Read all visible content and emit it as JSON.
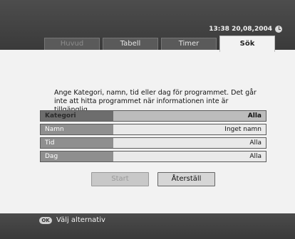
{
  "header": {
    "datetime": "13:38 20,08,2004",
    "clock_icon": "clock-icon"
  },
  "tabs": [
    {
      "label": "Huvud",
      "state": "dim"
    },
    {
      "label": "Tabell",
      "state": "normal"
    },
    {
      "label": "Timer",
      "state": "normal"
    },
    {
      "label": "Sök",
      "state": "active"
    }
  ],
  "main": {
    "instructions": "Ange Kategori, namn, tid eller dag för programmet. Det går inte att hitta programmet när informationen inte är tillgänglig.",
    "fields": [
      {
        "label": "Kategori",
        "value": "Alla"
      },
      {
        "label": "Namn",
        "value": "Inget namn"
      },
      {
        "label": "Tid",
        "value": "Alla"
      },
      {
        "label": "Dag",
        "value": "Alla"
      }
    ],
    "buttons": {
      "start_label": "Start",
      "reset_label": "Återställ"
    }
  },
  "footer": {
    "ok_icon_text": "OK",
    "hint": "Välj alternativ"
  },
  "colors": {
    "header_bg": "#4d4d4d",
    "content_bg": "#f2f2f2"
  }
}
